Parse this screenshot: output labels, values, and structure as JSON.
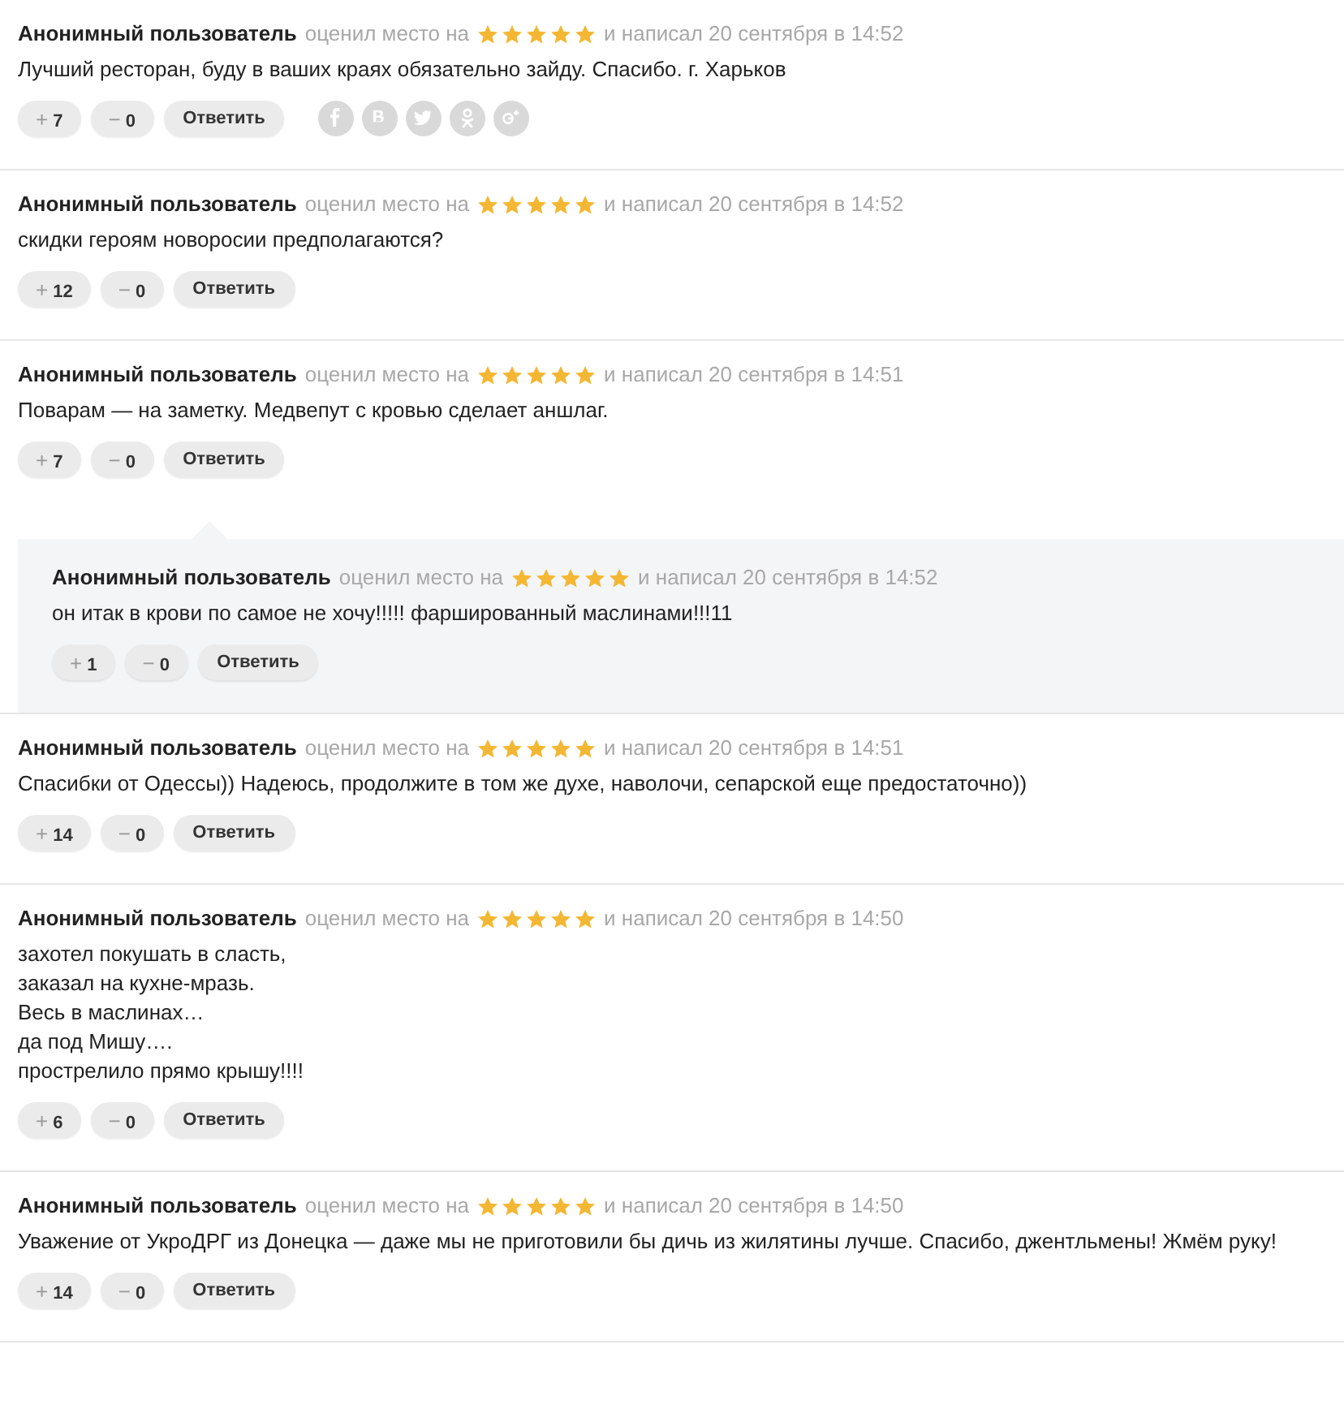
{
  "comments": [
    {
      "author": "Анонимный пользователь",
      "rated": "оценил место на",
      "stars": 5,
      "wrote": "и написал 20 сентября в 14:52",
      "body": [
        "Лучший ресторан, буду в ваших краях обязательно зайду. Спасибо. г. Харьков"
      ],
      "up": {
        "sign": "+",
        "count": "7"
      },
      "down": {
        "sign": "−",
        "count": "0"
      },
      "reply": "Ответить",
      "share": [
        {
          "kind": "facebook"
        },
        {
          "kind": "vk"
        },
        {
          "kind": "twitter"
        },
        {
          "kind": "odnoklassniki"
        },
        {
          "kind": "googleplus"
        }
      ]
    },
    {
      "author": "Анонимный пользователь",
      "rated": "оценил место на",
      "stars": 5,
      "wrote": "и написал 20 сентября в 14:52",
      "body": [
        "скидки героям новоросии предполагаются?"
      ],
      "up": {
        "sign": "+",
        "count": "12"
      },
      "down": {
        "sign": "−",
        "count": "0"
      },
      "reply": "Ответить"
    },
    {
      "author": "Анонимный пользователь",
      "rated": "оценил место на",
      "stars": 5,
      "wrote": "и написал 20 сентября в 14:51",
      "body": [
        "Поварам — на заметку. Медвепут с кровью сделает аншлаг."
      ],
      "up": {
        "sign": "+",
        "count": "7"
      },
      "down": {
        "sign": "−",
        "count": "0"
      },
      "reply": "Ответить",
      "children": [
        {
          "author": "Анонимный пользователь",
          "rated": "оценил место на",
          "stars": 5,
          "wrote": "и написал 20 сентября в 14:52",
          "body": [
            "он итак в крови по самое не хочу!!!!! фаршированный маслинами!!!11"
          ],
          "up": {
            "sign": "+",
            "count": "1"
          },
          "down": {
            "sign": "−",
            "count": "0"
          },
          "reply": "Ответить"
        }
      ]
    },
    {
      "author": "Анонимный пользователь",
      "rated": "оценил место на",
      "stars": 5,
      "wrote": "и написал 20 сентября в 14:51",
      "body": [
        "Спасибки от Одессы)) Надеюсь, продолжите в том же духе, наволочи, сепарской еще предостаточно))"
      ],
      "up": {
        "sign": "+",
        "count": "14"
      },
      "down": {
        "sign": "−",
        "count": "0"
      },
      "reply": "Ответить"
    },
    {
      "author": "Анонимный пользователь",
      "rated": "оценил место на",
      "stars": 5,
      "wrote": "и написал 20 сентября в 14:50",
      "body": [
        "захотел покушать в сласть,",
        "заказал на кухне-мразь.",
        "Весь в маслинах…",
        "да под Мишу….",
        "прострелило прямо крышу!!!!"
      ],
      "up": {
        "sign": "+",
        "count": "6"
      },
      "down": {
        "sign": "−",
        "count": "0"
      },
      "reply": "Ответить"
    },
    {
      "author": "Анонимный пользователь",
      "rated": "оценил место на",
      "stars": 5,
      "wrote": "и написал 20 сентября в 14:50",
      "body": [
        "Уважение от УкроДРГ из Донецка — даже мы не приготовили бы дичь из жилятины лучше. Спасибо, джентльмены! Жмём руку!"
      ],
      "up": {
        "sign": "+",
        "count": "14"
      },
      "down": {
        "sign": "−",
        "count": "0"
      },
      "reply": "Ответить"
    }
  ]
}
